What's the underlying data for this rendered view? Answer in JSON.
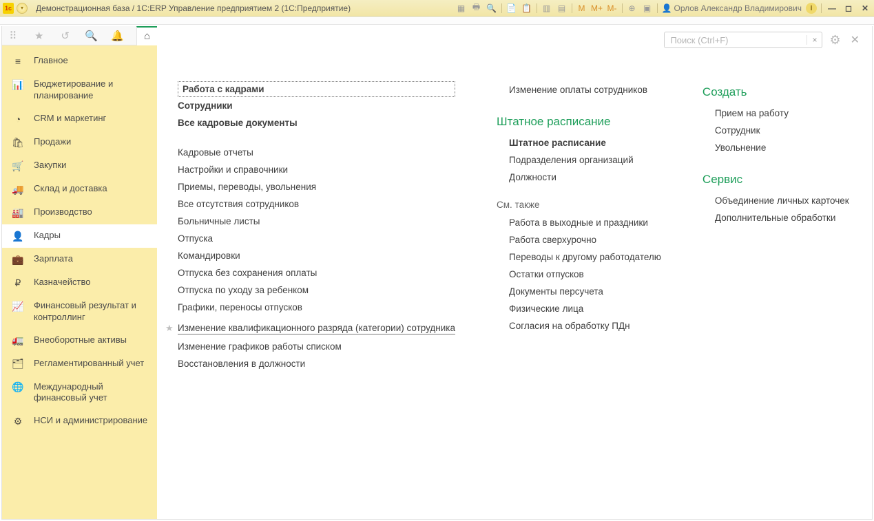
{
  "title": "Демонстрационная база / 1С:ERP Управление предприятием 2  (1С:Предприятие)",
  "logo_text": "1c",
  "user_name": "Орлов Александр Владимирович",
  "toolbar_icons": {
    "m": "M",
    "m_plus": "M+",
    "m_minus": "M-"
  },
  "search": {
    "placeholder": "Поиск (Ctrl+F)",
    "clear": "×"
  },
  "nav": [
    {
      "icon": "≡",
      "label": "Главное"
    },
    {
      "icon": "📊",
      "label": "Бюджетирование и планирование"
    },
    {
      "icon": "◔",
      "label": "CRM и маркетинг"
    },
    {
      "icon": "🛍",
      "label": "Продажи"
    },
    {
      "icon": "🛒",
      "label": "Закупки"
    },
    {
      "icon": "🚚",
      "label": "Склад и доставка"
    },
    {
      "icon": "🏭",
      "label": "Производство"
    },
    {
      "icon": "👤",
      "label": "Кадры"
    },
    {
      "icon": "💼",
      "label": "Зарплата"
    },
    {
      "icon": "₽",
      "label": "Казначейство"
    },
    {
      "icon": "📈",
      "label": "Финансовый результат и контроллинг"
    },
    {
      "icon": "🚛",
      "label": "Внеоборотные активы"
    },
    {
      "icon": "🗂",
      "label": "Регламентированный учет"
    },
    {
      "icon": "🌐",
      "label": "Международный финансовый учет"
    },
    {
      "icon": "⚙",
      "label": "НСИ и администрирование"
    }
  ],
  "nav_active_index": 7,
  "col1": {
    "group1": [
      {
        "text": "Работа с кадрами",
        "framed": true,
        "bold": true
      },
      {
        "text": "Сотрудники",
        "bold": true
      },
      {
        "text": "Все кадровые документы",
        "bold": true
      }
    ],
    "group2": [
      "Кадровые отчеты",
      "Настройки и справочники",
      "Приемы, переводы, увольнения",
      "Все отсутствия сотрудников",
      "Больничные листы",
      "Отпуска",
      "Командировки",
      "Отпуска без сохранения оплаты",
      "Отпуска по уходу за ребенком",
      "Графики, переносы отпусков"
    ],
    "starred": "Изменение квалификационного разряда (категории) сотрудника",
    "group3": [
      "Изменение графиков работы списком",
      "Восстановления в должности"
    ]
  },
  "col2": {
    "top": "Изменение оплаты сотрудников",
    "head1": "Штатное расписание",
    "head1_items": [
      "Штатное расписание",
      "Подразделения организаций",
      "Должности"
    ],
    "sect": "См. также",
    "sect_items": [
      "Работа в выходные и праздники",
      "Работа сверхурочно",
      "Переводы к другому работодателю",
      "Остатки отпусков",
      "Документы персучета",
      "Физические лица",
      "Согласия на обработку ПДн"
    ]
  },
  "col3": {
    "head1": "Создать",
    "head1_items": [
      "Прием на работу",
      "Сотрудник",
      "Увольнение"
    ],
    "head2": "Сервис",
    "head2_items": [
      "Объединение личных карточек",
      "Дополнительные обработки"
    ]
  }
}
